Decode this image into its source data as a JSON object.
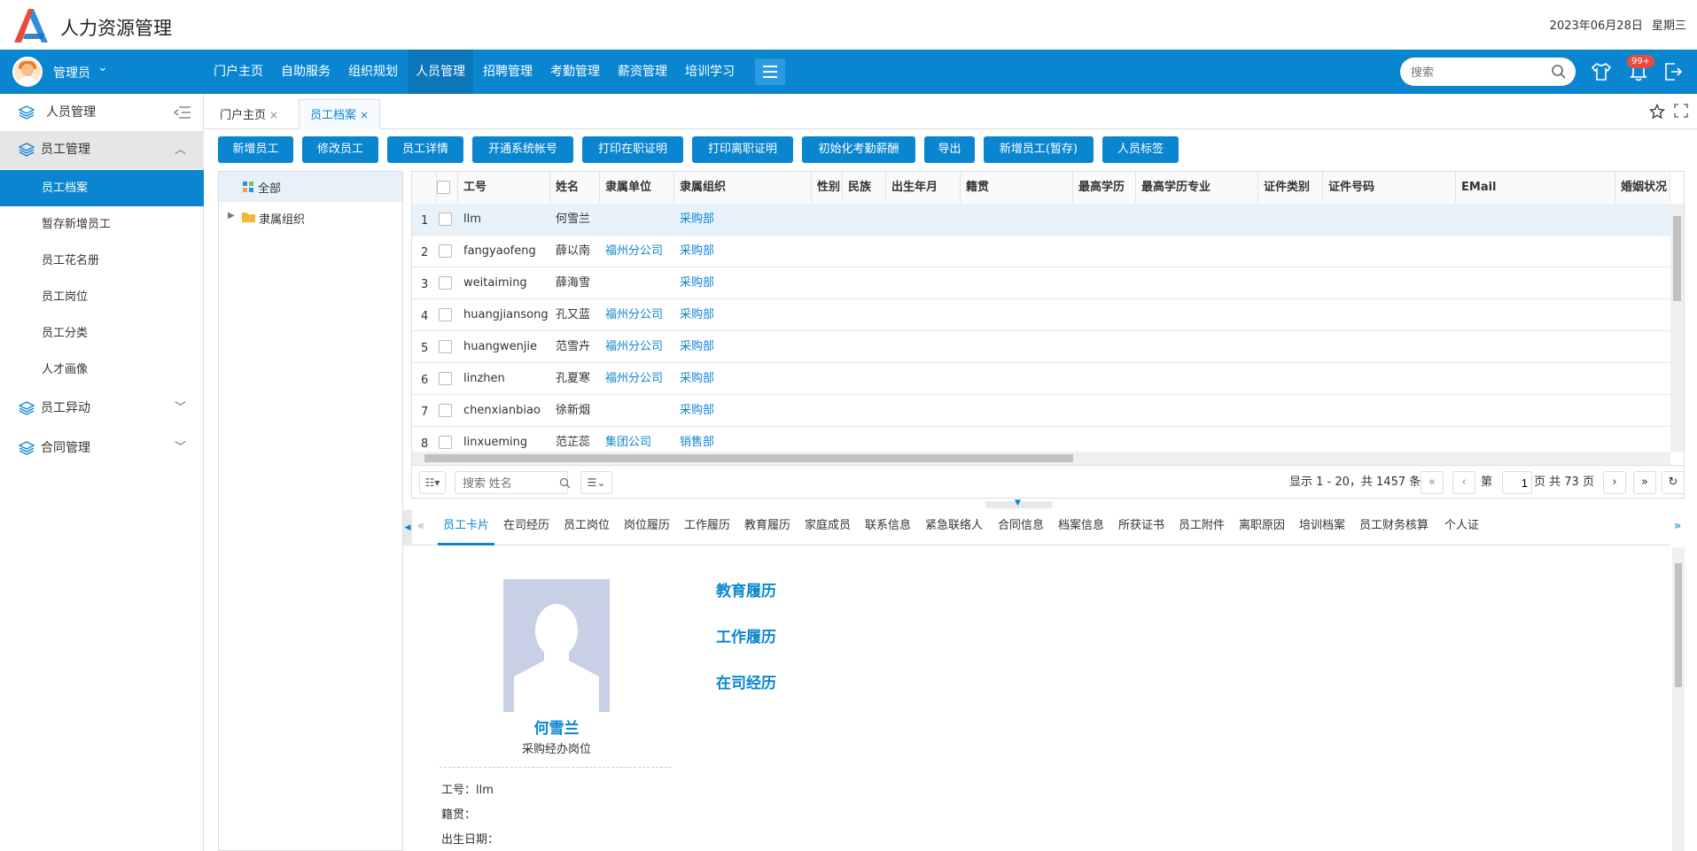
{
  "header": {
    "app_title": "人力资源管理",
    "date": "2023年06月28日",
    "weekday": "星期三"
  },
  "nav": {
    "user": "管理员",
    "items": [
      "门户主页",
      "自助服务",
      "组织规划",
      "人员管理",
      "招聘管理",
      "考勤管理",
      "薪资管理",
      "培训学习"
    ],
    "active_index": 3,
    "search_placeholder": "搜索",
    "notification_badge": "99+"
  },
  "sidebar": {
    "title": "人员管理",
    "groups": [
      {
        "label": "员工管理",
        "expanded": true,
        "items": [
          "员工档案",
          "暂存新增员工",
          "员工花名册",
          "员工岗位",
          "员工分类",
          "人才画像"
        ],
        "active_item": 0
      },
      {
        "label": "员工异动",
        "expanded": false
      },
      {
        "label": "合同管理",
        "expanded": false
      }
    ]
  },
  "page_tabs": [
    {
      "label": "门户主页",
      "close": "×"
    },
    {
      "label": "员工档案",
      "close": "×",
      "active": true
    }
  ],
  "toolbar": [
    "新增员工",
    "修改员工",
    "员工详情",
    "开通系统帐号",
    "打印在职证明",
    "打印离职证明",
    "初始化考勤薪酬",
    "导出",
    "新增员工(暂存)",
    "人员标签"
  ],
  "tree": {
    "root": "全部",
    "child": "隶属组织"
  },
  "grid": {
    "columns": [
      "工号",
      "姓名",
      "隶属单位",
      "隶属组织",
      "性别",
      "民族",
      "出生年月",
      "籍贯",
      "最高学历",
      "最高学历专业",
      "证件类别",
      "证件号码",
      "EMail",
      "婚姻状况"
    ],
    "rows": [
      {
        "no": "1",
        "id": "llm",
        "name": "何雪兰",
        "unit": "",
        "org": "采购部"
      },
      {
        "no": "2",
        "id": "fangyaofeng",
        "name": "薛以南",
        "unit": "福州分公司",
        "org": "采购部"
      },
      {
        "no": "3",
        "id": "weitaiming",
        "name": "薛海雪",
        "unit": "",
        "org": "采购部"
      },
      {
        "no": "4",
        "id": "huangjiansong",
        "name": "孔又蓝",
        "unit": "福州分公司",
        "org": "采购部"
      },
      {
        "no": "5",
        "id": "huangwenjie",
        "name": "范雪卉",
        "unit": "福州分公司",
        "org": "采购部"
      },
      {
        "no": "6",
        "id": "linzhen",
        "name": "孔夏寒",
        "unit": "福州分公司",
        "org": "采购部"
      },
      {
        "no": "7",
        "id": "chenxianbiao",
        "name": "徐新烟",
        "unit": "",
        "org": "采购部"
      },
      {
        "no": "8",
        "id": "linxueming",
        "name": "范芷蕊",
        "unit": "集团公司",
        "org": "销售部"
      }
    ]
  },
  "pager": {
    "search_placeholder": "搜索 姓名",
    "summary": "显示 1 - 20，共 1457 条",
    "page_label_pre": "第",
    "page_value": "1",
    "page_label_post": "页 共 73 页"
  },
  "detail_tabs": [
    "员工卡片",
    "在司经历",
    "员工岗位",
    "岗位履历",
    "工作履历",
    "教育履历",
    "家庭成员",
    "联系信息",
    "紧急联络人",
    "合同信息",
    "档案信息",
    "所获证书",
    "员工附件",
    "离职原因",
    "培训档案",
    "员工财务核算",
    "个人证"
  ],
  "profile": {
    "name": "何雪兰",
    "position": "采购经办岗位",
    "sections": [
      "教育履历",
      "工作履历",
      "在司经历"
    ],
    "fields": [
      {
        "label": "工号：",
        "value": "llm"
      },
      {
        "label": "籍贯：",
        "value": ""
      },
      {
        "label": "出生日期：",
        "value": ""
      }
    ]
  },
  "colors": {
    "primary": "#0a86d0",
    "nav_active": "#0b76b8",
    "badge": "#e94b3c"
  }
}
